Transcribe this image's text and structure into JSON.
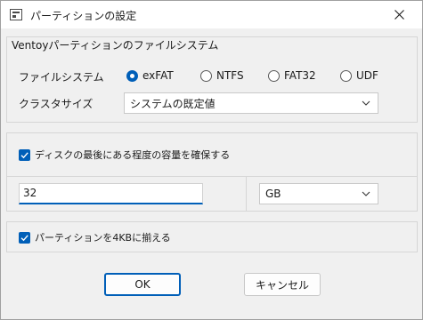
{
  "window": {
    "title": "パーティションの設定",
    "close_label": "✕"
  },
  "fs_group": {
    "legend": "Ventoyパーティションのファイルシステム",
    "fs_label": "ファイルシステム",
    "options": [
      {
        "label": "exFAT",
        "checked": true
      },
      {
        "label": "NTFS",
        "checked": false
      },
      {
        "label": "FAT32",
        "checked": false
      },
      {
        "label": "UDF",
        "checked": false
      }
    ],
    "cluster_label": "クラスタサイズ",
    "cluster_value": "システムの既定値"
  },
  "reserve": {
    "checkbox_label": "ディスクの最後にある程度の容量を確保する",
    "checked": true,
    "size_value": "32",
    "unit_value": "GB"
  },
  "align": {
    "checkbox_label": "パーティションを4KBに揃える",
    "checked": true
  },
  "buttons": {
    "ok_label": "OK",
    "cancel_label": "キャンセル"
  },
  "colors": {
    "accent": "#005fb8",
    "background": "#f0f0f0"
  }
}
